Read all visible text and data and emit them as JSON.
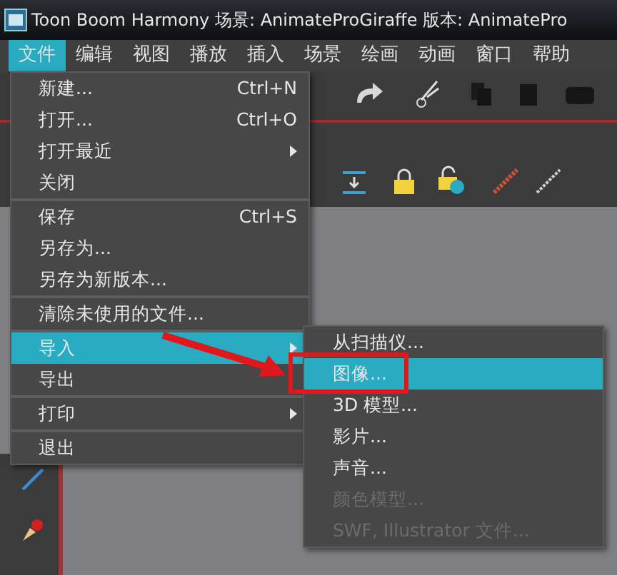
{
  "window": {
    "title": "Toon Boom Harmony 场景: AnimateProGiraffe 版本:  AnimatePro"
  },
  "menubar": [
    {
      "label": "文件",
      "selected": true
    },
    {
      "label": "编辑",
      "selected": false
    },
    {
      "label": "视图",
      "selected": false
    },
    {
      "label": "播放",
      "selected": false
    },
    {
      "label": "插入",
      "selected": false
    },
    {
      "label": "场景",
      "selected": false
    },
    {
      "label": "绘画",
      "selected": false
    },
    {
      "label": "动画",
      "selected": false
    },
    {
      "label": "窗口",
      "selected": false
    },
    {
      "label": "帮助",
      "selected": false
    }
  ],
  "file_menu": [
    {
      "label": "新建...",
      "shortcut": "Ctrl+N",
      "submenu": false,
      "separator_before": false,
      "selected": false
    },
    {
      "label": "打开...",
      "shortcut": "Ctrl+O",
      "submenu": false,
      "separator_before": false,
      "selected": false
    },
    {
      "label": "打开最近",
      "submenu": true,
      "separator_before": false,
      "selected": false
    },
    {
      "label": "关闭",
      "submenu": false,
      "separator_before": false,
      "selected": false
    },
    {
      "label": "保存",
      "shortcut": "Ctrl+S",
      "submenu": false,
      "separator_before": true,
      "selected": false
    },
    {
      "label": "另存为...",
      "submenu": false,
      "separator_before": false,
      "selected": false
    },
    {
      "label": "另存为新版本...",
      "submenu": false,
      "separator_before": false,
      "selected": false
    },
    {
      "label": "清除未使用的文件...",
      "submenu": false,
      "separator_before": true,
      "selected": false
    },
    {
      "label": "导入",
      "submenu": true,
      "separator_before": true,
      "selected": true
    },
    {
      "label": "导出",
      "submenu": false,
      "separator_before": false,
      "selected": false
    },
    {
      "label": "打印",
      "submenu": true,
      "separator_before": true,
      "selected": false
    },
    {
      "label": "退出",
      "submenu": false,
      "separator_before": true,
      "selected": false
    }
  ],
  "import_submenu": [
    {
      "label": "从扫描仪...",
      "disabled": false,
      "selected": false
    },
    {
      "label": "图像...",
      "disabled": false,
      "selected": true
    },
    {
      "label": "3D 模型...",
      "disabled": false,
      "selected": false
    },
    {
      "label": "影片...",
      "disabled": false,
      "selected": false
    },
    {
      "label": "声音...",
      "disabled": false,
      "selected": false
    },
    {
      "label": "颜色模型...",
      "disabled": true,
      "selected": false
    },
    {
      "label": "SWF, Illustrator 文件...",
      "disabled": true,
      "selected": false
    }
  ]
}
